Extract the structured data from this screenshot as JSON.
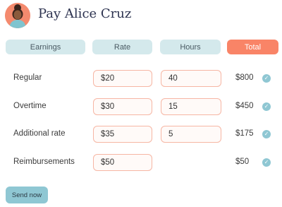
{
  "header": {
    "title": "Pay Alice Cruz"
  },
  "columns": {
    "earnings": "Earnings",
    "rate": "Rate",
    "hours": "Hours",
    "total": "Total"
  },
  "rows": [
    {
      "label": "Regular",
      "rate": "$20",
      "hours": "40",
      "total": "$800"
    },
    {
      "label": "Overtime",
      "rate": "$30",
      "hours": "15",
      "total": "$450"
    },
    {
      "label": "Additional rate",
      "rate": "$35",
      "hours": "5",
      "total": "$175"
    },
    {
      "label": "Reimbursements",
      "rate": "$50",
      "total": "$50"
    }
  ],
  "actions": {
    "send_label": "Send now"
  },
  "colors": {
    "accent": "#f98467",
    "header_bg": "#d4e9ec",
    "button_bg": "#8fc7d3",
    "field_border": "#f6b6a4",
    "title": "#2d3350"
  },
  "icons": {
    "avatar": "avatar",
    "row_status": "check-circle-icon"
  }
}
